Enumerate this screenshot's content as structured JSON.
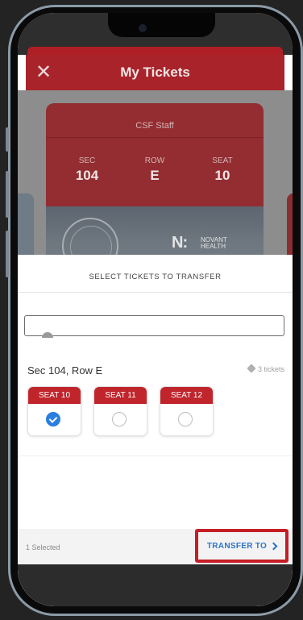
{
  "header": {
    "title": "My Tickets",
    "close_icon": "close-icon"
  },
  "ticket": {
    "group": "CSF Staff",
    "sec_label": "SEC",
    "sec_value": "104",
    "row_label": "ROW",
    "row_value": "E",
    "seat_label": "SEAT",
    "seat_value": "10",
    "sponsor_mark": "N:",
    "sponsor_name_line1": "NOVANT",
    "sponsor_name_line2": "HEALTH"
  },
  "sheet": {
    "title": "SELECT TICKETS TO TRANSFER",
    "section_label": "Sec 104, Row E",
    "tickets_count": "3 tickets",
    "seats": [
      {
        "label": "SEAT 10",
        "selected": true
      },
      {
        "label": "SEAT 11",
        "selected": false
      },
      {
        "label": "SEAT 12",
        "selected": false
      }
    ]
  },
  "footer": {
    "selected_text": "1 Selected",
    "transfer_label": "TRANSFER TO"
  },
  "colors": {
    "brand_red": "#c0252c",
    "accent_blue": "#2a7ee0",
    "highlight_red": "#c51e25"
  }
}
